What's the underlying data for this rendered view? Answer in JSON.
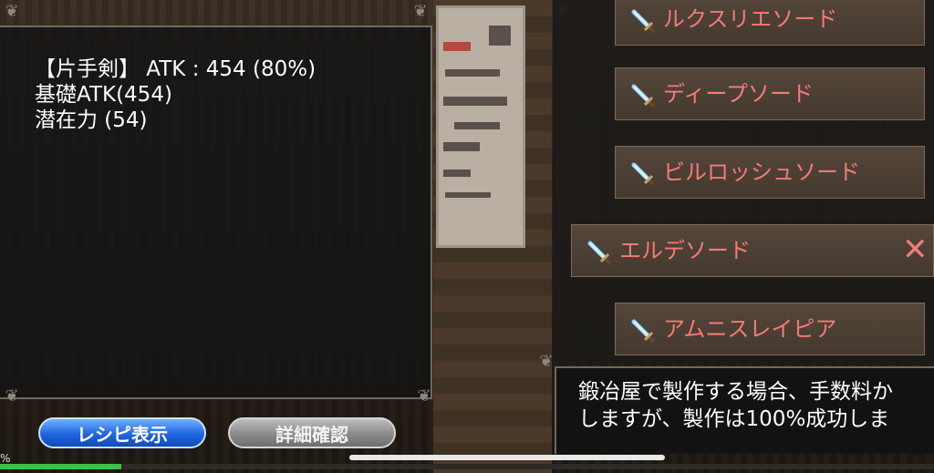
{
  "info": {
    "line1": "【片手剣】 ATK : 454 (80%)",
    "line2": "基礎ATK(454)",
    "line3": "潜在力 (54)"
  },
  "buttons": {
    "recipe": "レシピ表示",
    "detail": "詳細確認"
  },
  "swords": [
    {
      "label": "ルクスリエソード",
      "selected": false
    },
    {
      "label": "ディープソード",
      "selected": false
    },
    {
      "label": "ビルロッシュソード",
      "selected": false
    },
    {
      "label": "エルデソード",
      "selected": true
    },
    {
      "label": "アムニスレイピア",
      "selected": false
    }
  ],
  "close_symbol": "✕",
  "description": {
    "line1": "鍛冶屋で製作する場合、手数料か",
    "line2": "しますが、製作は100%成功しま"
  },
  "progress": {
    "label": "%",
    "value_percent": 13
  },
  "colors": {
    "item_text": "#f47b78",
    "recipe_button": "#1e66e0",
    "detail_button": "#8a8a8a"
  },
  "icons": [
    "sword-icon",
    "close-icon"
  ]
}
